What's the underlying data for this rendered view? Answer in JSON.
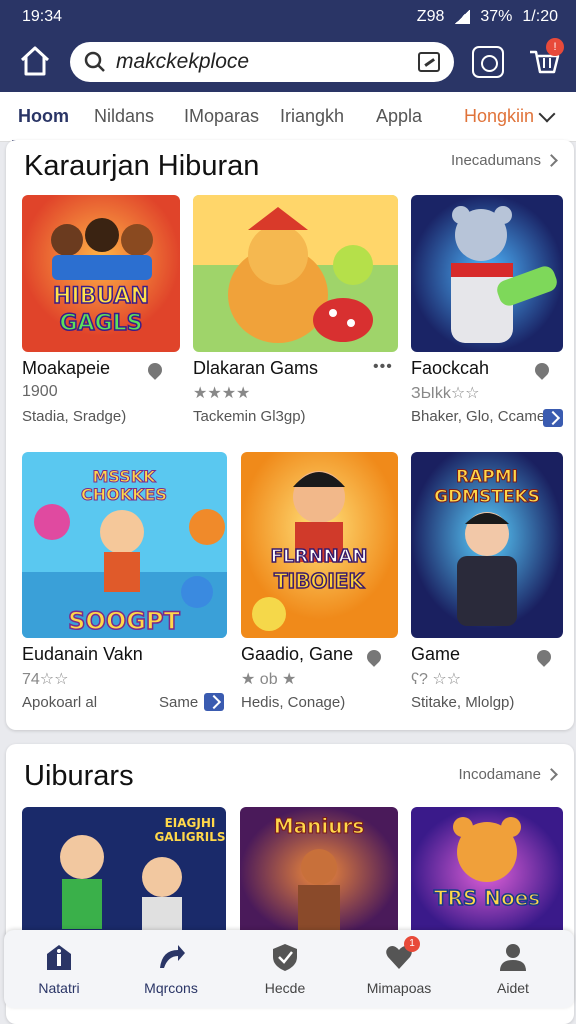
{
  "status": {
    "time": "19:34",
    "icons_text": "Z98",
    "battery": "37%",
    "clock2": "1/:20"
  },
  "search": {
    "value": "makckekploce"
  },
  "tabs": [
    {
      "label": "Hoom",
      "active": true
    },
    {
      "label": "Nildans"
    },
    {
      "label": "IMoparas"
    },
    {
      "label": "Iriangkh"
    },
    {
      "label": "Appla"
    },
    {
      "label": "Hongkiin",
      "accent": "#e0733a"
    }
  ],
  "section1": {
    "title": "Karaurjan Hiburan",
    "link": "Inecadumans",
    "tiles": [
      {
        "name": "Moakapeie",
        "meta": "1900",
        "cat": "Stadia, Sradge)",
        "art": "HIBUAN GAGLS"
      },
      {
        "name": "Dlakaran Gams",
        "meta": "★★★★",
        "cat": "Tackemin Gl3gp)",
        "art": ""
      },
      {
        "name": "Faockcah",
        "meta": "ЗЫkk☆☆",
        "cat": "Bhaker, Glo, Ccame",
        "art": ""
      },
      {
        "name": "Eudanain Vakn",
        "meta": "74☆☆",
        "cat": "Apokoarl al",
        "cat2": "Same",
        "art": "MSSKK CHOKKES"
      },
      {
        "name": "Gaadio, Gane",
        "meta": "★ ob ★",
        "cat": "Hedis, Conage)",
        "art": "FLRNNAN TIBOIEK"
      },
      {
        "name": "Game",
        "meta": "ʕ? ☆☆",
        "cat": "Stitake, Mlolgp)",
        "art": "RAPMI GDMSTEKS"
      }
    ]
  },
  "section2": {
    "title": "Uiburars",
    "link": "Incodamane",
    "tiles": [
      {
        "art": "EIAGJHI GALIGRILS"
      },
      {
        "art": "Maniurs"
      },
      {
        "art": "TRS Noes"
      }
    ]
  },
  "bottom_nav": [
    {
      "label": "Natatri",
      "icon": "info-icon",
      "active": true
    },
    {
      "label": "Mqrcons",
      "icon": "arrow-icon",
      "active": true
    },
    {
      "label": "Hecde",
      "icon": "shield-icon"
    },
    {
      "label": "Mimapoas",
      "icon": "heart-icon",
      "badge": "1"
    },
    {
      "label": "Aidet",
      "icon": "person-icon"
    }
  ],
  "colors": {
    "appbar": "#2a3566",
    "accent": "#e0733a",
    "badge": "#e84a3a"
  }
}
